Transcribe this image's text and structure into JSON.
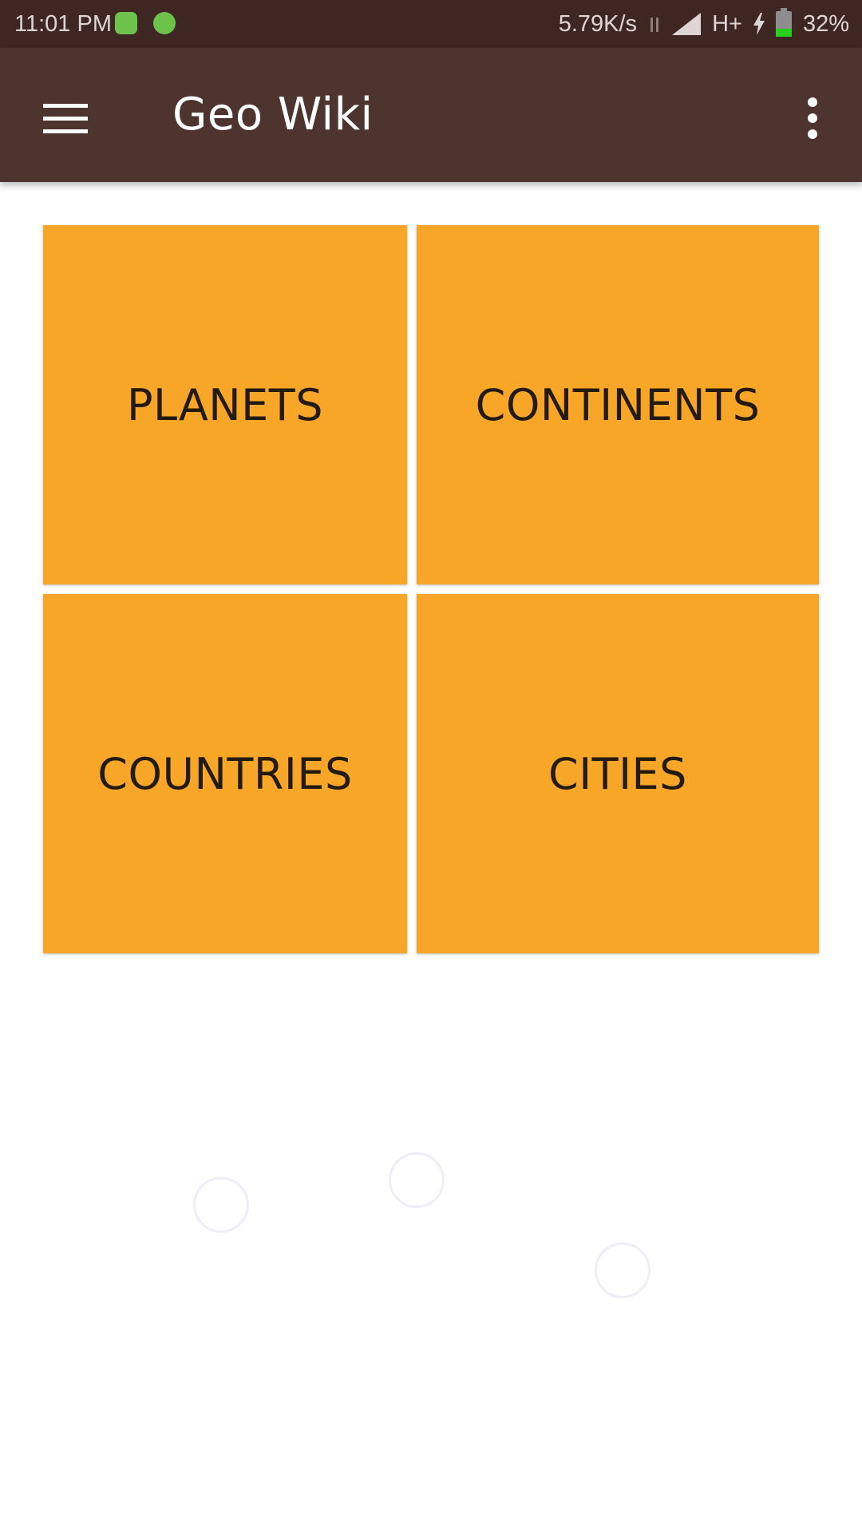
{
  "status_bar": {
    "time": "11:01 PM",
    "network_speed": "5.79K/s",
    "network_type": "H+",
    "battery_percent": "32%",
    "battery_level": 0.32,
    "notification_icons": [
      "phone-app-icon",
      "android-app-icon"
    ],
    "battery_color": "#27d11c"
  },
  "app_bar": {
    "title": "Geo Wiki",
    "background_color": "#4e342e",
    "left_icon": "menu-icon",
    "right_icon": "overflow-menu-icon"
  },
  "tiles": [
    {
      "label": "PLANETS"
    },
    {
      "label": "CONTINENTS"
    },
    {
      "label": "COUNTRIES"
    },
    {
      "label": "CITIES"
    }
  ],
  "theme": {
    "tile_color": "#f8a627",
    "tile_text_color": "#231a10",
    "status_bar_color": "#3e2723"
  }
}
